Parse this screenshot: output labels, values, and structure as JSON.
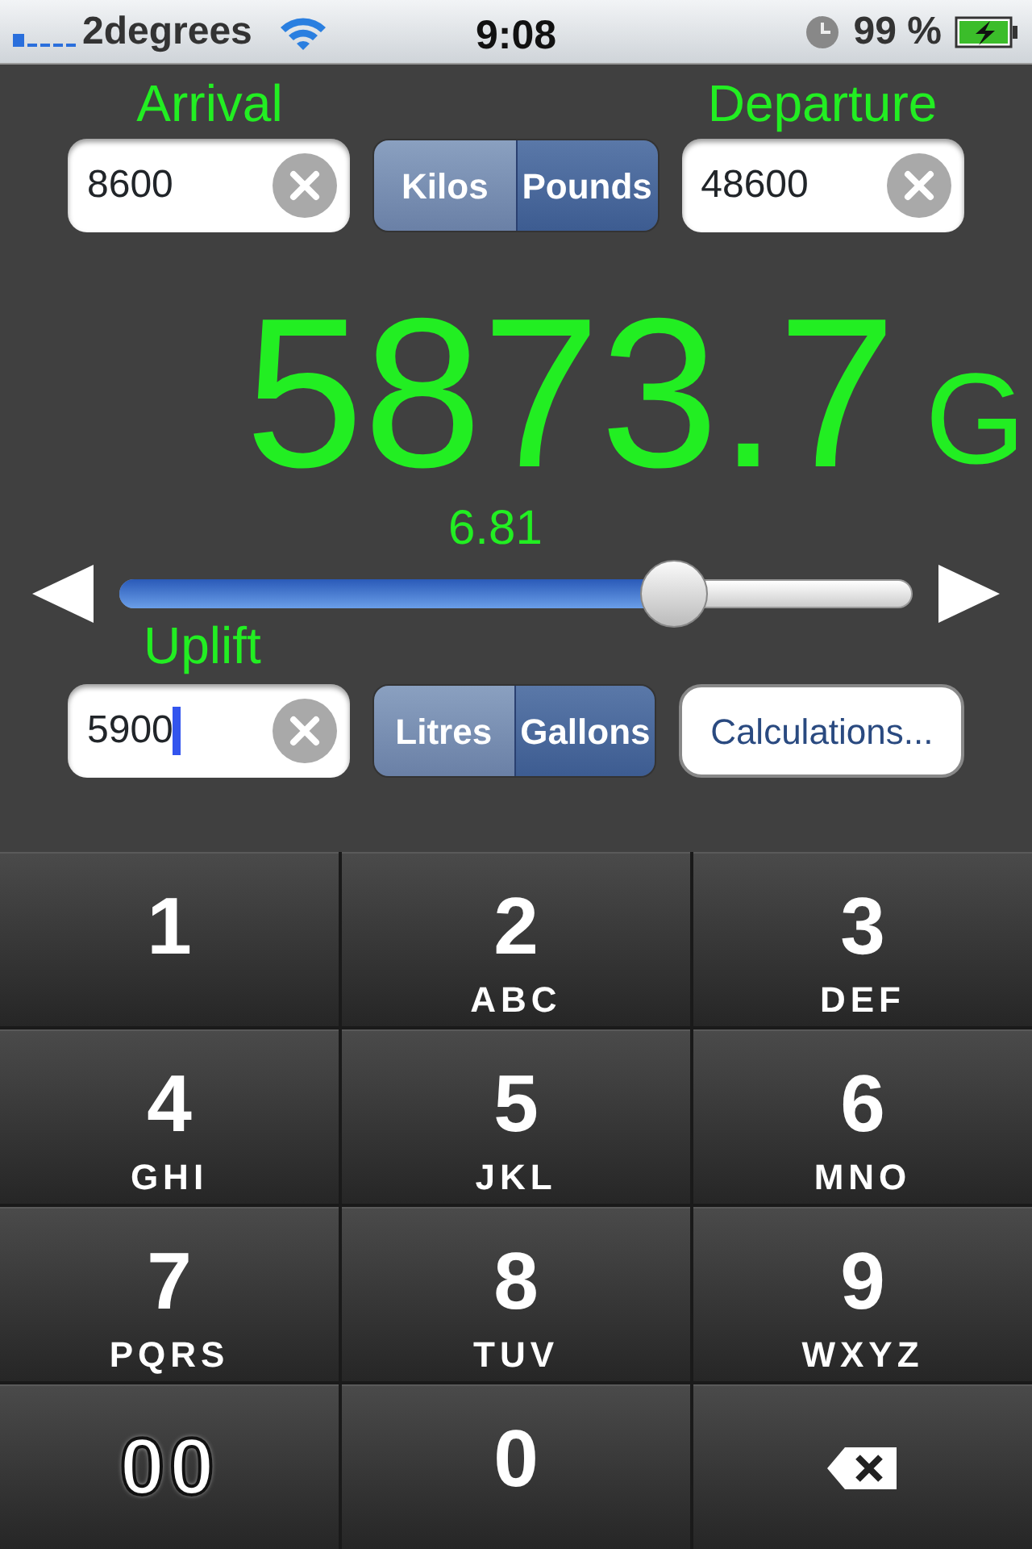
{
  "status_bar": {
    "carrier": "2degrees",
    "time": "9:08",
    "battery_percent": "99 %",
    "charging": true
  },
  "weight": {
    "labels": [
      {
        "text": "Arrival"
      },
      {
        "text": "Departure"
      }
    ],
    "fields": [
      {
        "value": "8600",
        "focused": false
      },
      {
        "value": "48600",
        "focused": false
      }
    ],
    "units": [
      {
        "label": "Kilos",
        "selected": false
      },
      {
        "label": "Pounds",
        "selected": true
      }
    ]
  },
  "result": {
    "value": "5873.7",
    "unit": "G"
  },
  "ratio": {
    "reading": "6.81",
    "level": 0.7
  },
  "uplift": {
    "label": "Uplift",
    "field": {
      "value": "5900",
      "focused": true
    },
    "units": [
      {
        "label": "Litres",
        "selected": false
      },
      {
        "label": "Gallons",
        "selected": true
      }
    ],
    "button": "Calculations..."
  },
  "keypad": [
    {
      "kind": "digit",
      "digit": "1"
    },
    {
      "kind": "digit",
      "digit": "2",
      "letters": "ABC"
    },
    {
      "kind": "digit",
      "digit": "3",
      "letters": "DEF"
    },
    {
      "kind": "digit",
      "digit": "4",
      "letters": "GHI"
    },
    {
      "kind": "digit",
      "digit": "5",
      "letters": "JKL"
    },
    {
      "kind": "digit",
      "digit": "6",
      "letters": "MNO"
    },
    {
      "kind": "digit",
      "digit": "7",
      "letters": "PQRS"
    },
    {
      "kind": "digit",
      "digit": "8",
      "letters": "TUV"
    },
    {
      "kind": "digit",
      "digit": "9",
      "letters": "WXYZ"
    },
    {
      "kind": "outlined",
      "digit": "00"
    },
    {
      "kind": "digit",
      "digit": "0"
    },
    {
      "kind": "backspace"
    }
  ]
}
